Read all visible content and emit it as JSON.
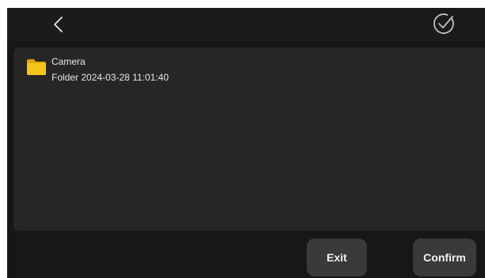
{
  "header": {
    "back_icon": "chevron-left-icon",
    "confirm_icon": "check-circle-icon"
  },
  "file_list": {
    "items": [
      {
        "icon": "folder-icon",
        "icon_color": "#f5c518",
        "name": "Camera",
        "meta": "Folder 2024-03-28 11:01:40"
      }
    ]
  },
  "footer": {
    "exit_label": "Exit",
    "confirm_label": "Confirm"
  },
  "colors": {
    "background": "#171717",
    "panel": "#262626",
    "button": "#3a3a3a",
    "folder": "#f5c518"
  }
}
